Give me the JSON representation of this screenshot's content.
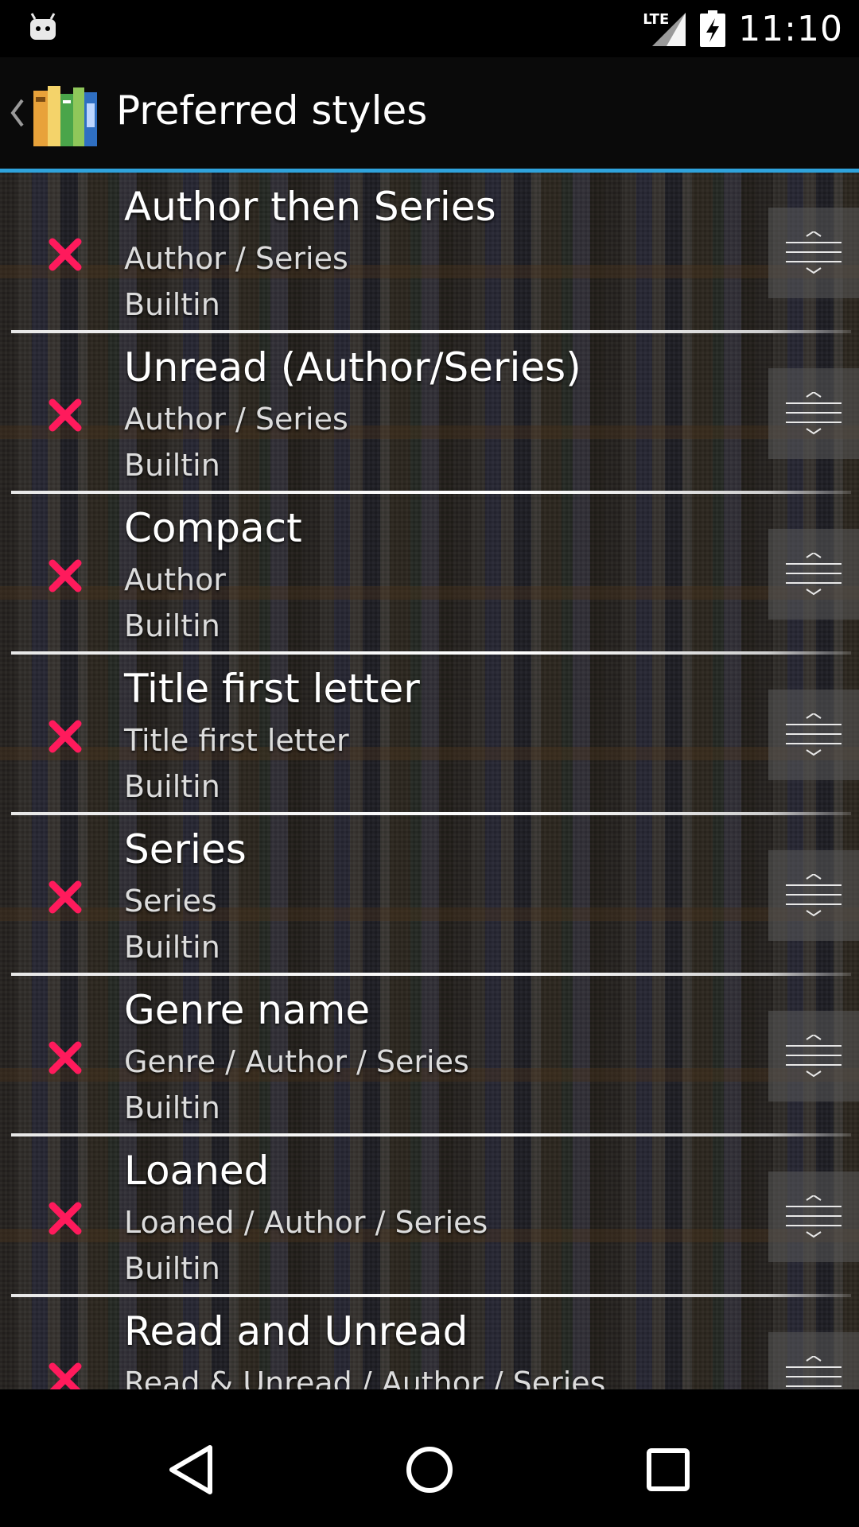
{
  "status_bar": {
    "notification_icon": "android-robot-icon",
    "network_label": "LTE",
    "time": "11:10"
  },
  "action_bar": {
    "back_icon": "chevron-left-icon",
    "app_icon": "books-icon",
    "title": "Preferred styles"
  },
  "styles": [
    {
      "title": "Author then Series",
      "subtitle": "Author / Series",
      "type": "Builtin"
    },
    {
      "title": "Unread (Author/Series)",
      "subtitle": "Author / Series",
      "type": "Builtin"
    },
    {
      "title": "Compact",
      "subtitle": "Author",
      "type": "Builtin"
    },
    {
      "title": "Title first letter",
      "subtitle": "Title first letter",
      "type": "Builtin"
    },
    {
      "title": "Series",
      "subtitle": "Series",
      "type": "Builtin"
    },
    {
      "title": "Genre name",
      "subtitle": "Genre / Author / Series",
      "type": "Builtin"
    },
    {
      "title": "Loaned",
      "subtitle": "Loaned / Author / Series",
      "type": "Builtin"
    },
    {
      "title": "Read and Unread",
      "subtitle": "Read & Unread / Author / Series",
      "type": ""
    }
  ],
  "icons": {
    "delete": "delete-x-icon",
    "drag": "drag-handle-icon"
  },
  "colors": {
    "accent": "#2fa3dc",
    "delete": "#ff1a5c"
  },
  "nav_bar": {
    "back": "back-triangle-icon",
    "home": "home-circle-icon",
    "recents": "recents-square-icon"
  }
}
